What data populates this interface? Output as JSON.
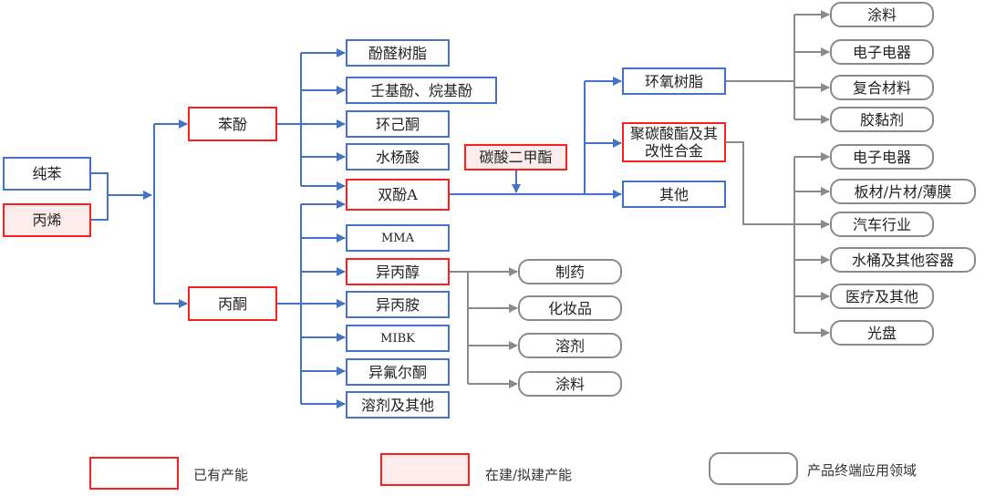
{
  "colors": {
    "existing_border": "#FF1E1E",
    "planned_fill": "#FDECEC",
    "material_border": "#4472C4",
    "end_use_border": "#8A8A8A"
  },
  "raw_materials": {
    "benzene": "纯苯",
    "propylene": "丙烯"
  },
  "intermediates": {
    "phenol": "苯酚",
    "acetone": "丙酮",
    "dmc": "碳酸二甲酯"
  },
  "phenol_products": [
    "酚醛树脂",
    "壬基酚、烷基酚",
    "环己酮",
    "水杨酸",
    "双酚A"
  ],
  "acetone_products": [
    "MMA",
    "异丙醇",
    "异丙胺",
    "MIBK",
    "异氟尔酮",
    "溶剂及其他"
  ],
  "bpa_products": {
    "epoxy": "环氧树脂",
    "pc": "聚碳酸酯及其改性合金",
    "other": "其他"
  },
  "ipa_end_uses": [
    "制药",
    "化妆品",
    "溶剂",
    "涂料"
  ],
  "epoxy_end_uses": [
    "涂料",
    "电子电器",
    "复合材料",
    "胶黏剂"
  ],
  "pc_end_uses": [
    "电子电器",
    "板材/片材/薄膜",
    "汽车行业",
    "水桶及其他容器",
    "医疗及其他",
    "光盘"
  ],
  "legend": {
    "existing": "已有产能",
    "planned": "在建/拟建产能",
    "end_use": "产品终端应用领域"
  }
}
